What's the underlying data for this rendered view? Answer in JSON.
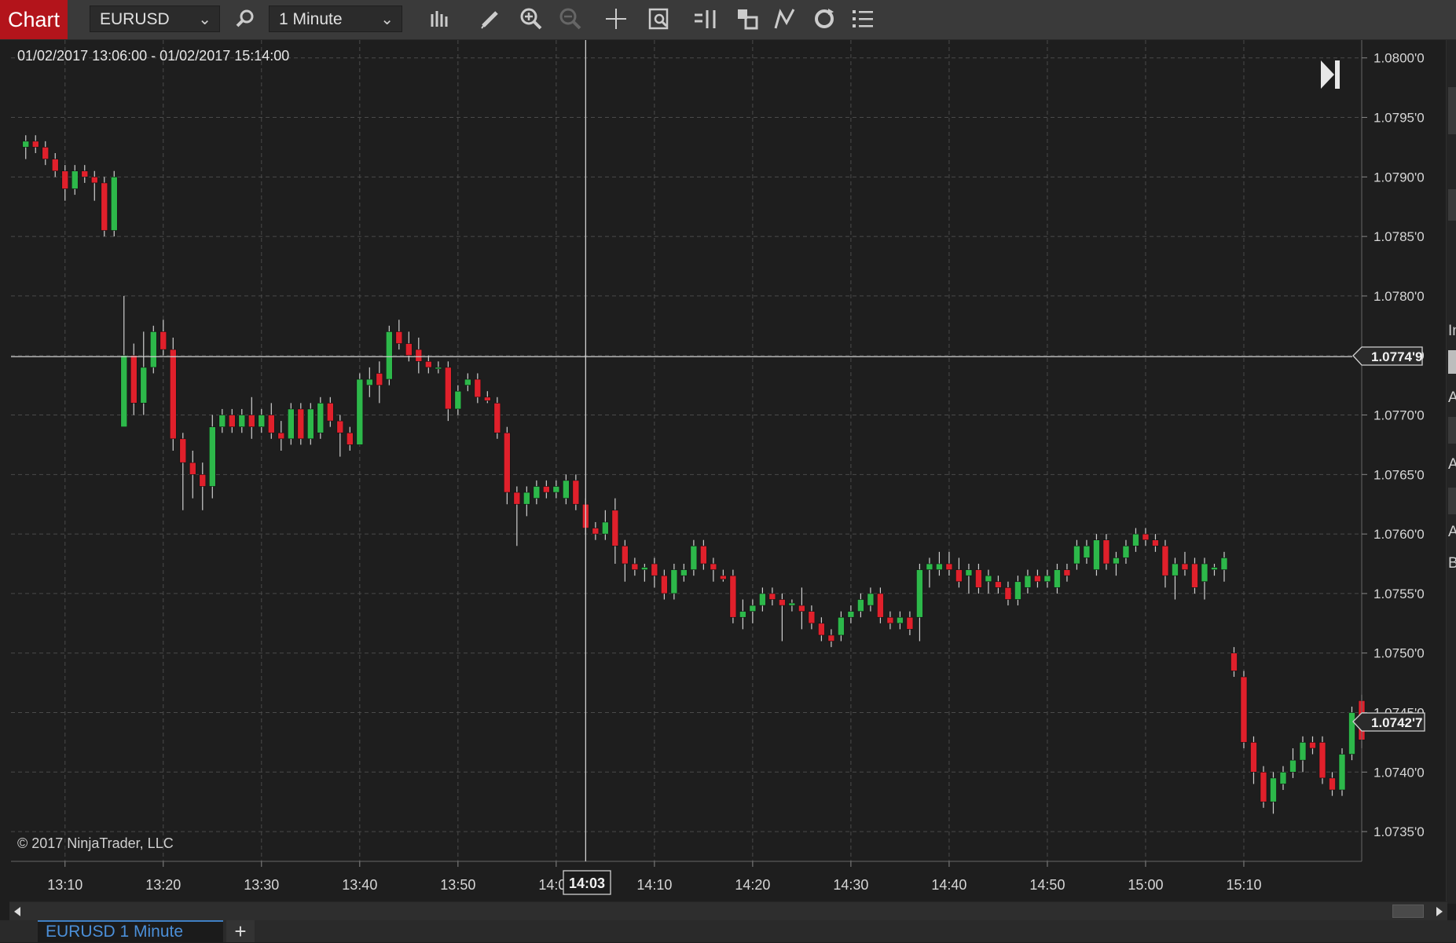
{
  "toolbar": {
    "tab_label": "Chart",
    "instrument": "EURUSD",
    "interval": "1 Minute",
    "icons": [
      "search-icon",
      "bar-type-icon",
      "drawing-pencil-icon",
      "zoom-in-icon",
      "zoom-out-icon",
      "crosshair-icon",
      "data-box-icon",
      "bar-spacing-icon",
      "overlay-icon",
      "indicators-icon",
      "reload-icon",
      "properties-list-icon"
    ]
  },
  "chart": {
    "date_range": "01/02/2017 13:06:00 - 01/02/2017 15:14:00",
    "copyright": "© 2017 NinjaTrader, LLC",
    "crosshair_time": "14:03",
    "crosshair_price": "1.0774'9",
    "last_price": "1.0742'7",
    "colors": {
      "up": "#2db84a",
      "down": "#e0202b",
      "background": "#1e1e1e",
      "grid": "#4a4a4a"
    }
  },
  "chart_data": {
    "type": "candlestick",
    "y_ticks": [
      "1.0800'0",
      "1.0795'0",
      "1.0790'0",
      "1.0785'0",
      "1.0780'0",
      "1.0775'0",
      "1.0770'0",
      "1.0765'0",
      "1.0760'0",
      "1.0755'0",
      "1.0750'0",
      "1.0745'0",
      "1.0740'0",
      "1.0735'0"
    ],
    "x_ticks": [
      "13:10",
      "13:20",
      "13:30",
      "13:40",
      "13:50",
      "14:00",
      "14:10",
      "14:20",
      "14:30",
      "14:40",
      "14:50",
      "15:00",
      "15:10"
    ],
    "ylim": [
      1.07325,
      1.08015
    ],
    "xlim_minutes_from_1306": [
      -1.5,
      136
    ],
    "candles": [
      [
        0,
        1.07925,
        1.07935,
        1.07915,
        1.0793
      ],
      [
        1,
        1.0793,
        1.07935,
        1.0792,
        1.07925
      ],
      [
        2,
        1.07925,
        1.0793,
        1.0791,
        1.07915
      ],
      [
        3,
        1.07915,
        1.0792,
        1.079,
        1.07905
      ],
      [
        4,
        1.07905,
        1.0791,
        1.0788,
        1.0789
      ],
      [
        5,
        1.0789,
        1.0791,
        1.07885,
        1.07905
      ],
      [
        6,
        1.07905,
        1.0791,
        1.07895,
        1.079
      ],
      [
        7,
        1.079,
        1.07905,
        1.0788,
        1.07895
      ],
      [
        8,
        1.07895,
        1.079,
        1.0785,
        1.07855
      ],
      [
        9,
        1.07855,
        1.07905,
        1.0785,
        1.079
      ],
      [
        10,
        1.0769,
        1.078,
        1.0769,
        1.0775
      ],
      [
        11,
        1.0775,
        1.0776,
        1.077,
        1.0771
      ],
      [
        12,
        1.0771,
        1.0777,
        1.077,
        1.0774
      ],
      [
        13,
        1.0774,
        1.07775,
        1.07735,
        1.0777
      ],
      [
        14,
        1.0777,
        1.0778,
        1.0775,
        1.07755
      ],
      [
        15,
        1.07755,
        1.07765,
        1.0767,
        1.0768
      ],
      [
        16,
        1.0768,
        1.07685,
        1.0762,
        1.0766
      ],
      [
        17,
        1.0766,
        1.0767,
        1.0763,
        1.0765
      ],
      [
        18,
        1.0765,
        1.0766,
        1.0762,
        1.0764
      ],
      [
        19,
        1.0764,
        1.077,
        1.0763,
        1.0769
      ],
      [
        20,
        1.0769,
        1.07705,
        1.07685,
        1.077
      ],
      [
        21,
        1.077,
        1.07705,
        1.07685,
        1.0769
      ],
      [
        22,
        1.0769,
        1.07705,
        1.07685,
        1.077
      ],
      [
        23,
        1.077,
        1.07715,
        1.0768,
        1.0769
      ],
      [
        24,
        1.0769,
        1.07705,
        1.07685,
        1.077
      ],
      [
        25,
        1.077,
        1.0771,
        1.0768,
        1.07685
      ],
      [
        26,
        1.07685,
        1.07695,
        1.0767,
        1.0768
      ],
      [
        27,
        1.0768,
        1.0771,
        1.07675,
        1.07705
      ],
      [
        28,
        1.07705,
        1.0771,
        1.07675,
        1.0768
      ],
      [
        29,
        1.0768,
        1.0771,
        1.07675,
        1.07705
      ],
      [
        30,
        1.07685,
        1.07715,
        1.0768,
        1.0771
      ],
      [
        31,
        1.0771,
        1.07715,
        1.0769,
        1.07695
      ],
      [
        32,
        1.07695,
        1.077,
        1.07665,
        1.07685
      ],
      [
        33,
        1.07685,
        1.0769,
        1.0767,
        1.07675
      ],
      [
        34,
        1.07675,
        1.07735,
        1.07675,
        1.0773
      ],
      [
        35,
        1.07725,
        1.0774,
        1.07715,
        1.0773
      ],
      [
        36,
        1.07735,
        1.07745,
        1.0771,
        1.07725
      ],
      [
        37,
        1.0773,
        1.07775,
        1.07725,
        1.0777
      ],
      [
        38,
        1.0777,
        1.0778,
        1.07755,
        1.0776
      ],
      [
        39,
        1.0776,
        1.0777,
        1.07745,
        1.0775
      ],
      [
        40,
        1.07755,
        1.07765,
        1.07735,
        1.07745
      ],
      [
        41,
        1.07745,
        1.0775,
        1.07735,
        1.0774
      ],
      [
        42,
        1.0774,
        1.07745,
        1.07735,
        1.0774
      ],
      [
        43,
        1.0774,
        1.07745,
        1.07695,
        1.07705
      ],
      [
        44,
        1.07705,
        1.07725,
        1.077,
        1.0772
      ],
      [
        45,
        1.07725,
        1.07735,
        1.0772,
        1.0773
      ],
      [
        46,
        1.0773,
        1.07735,
        1.0771,
        1.07715
      ],
      [
        47,
        1.07715,
        1.0772,
        1.0771,
        1.07712
      ],
      [
        48,
        1.0771,
        1.07715,
        1.0768,
        1.07685
      ],
      [
        49,
        1.07685,
        1.0769,
        1.07625,
        1.07635
      ],
      [
        50,
        1.07635,
        1.0764,
        1.0759,
        1.07625
      ],
      [
        51,
        1.07625,
        1.0764,
        1.07615,
        1.07635
      ],
      [
        52,
        1.0763,
        1.07645,
        1.07625,
        1.0764
      ],
      [
        53,
        1.0764,
        1.07645,
        1.0763,
        1.07635
      ],
      [
        54,
        1.07635,
        1.07645,
        1.0763,
        1.0764
      ],
      [
        55,
        1.0763,
        1.0765,
        1.07625,
        1.07645
      ],
      [
        56,
        1.07645,
        1.0765,
        1.0762,
        1.07625
      ],
      [
        57,
        1.07625,
        1.0763,
        1.076,
        1.07605
      ],
      [
        58,
        1.07605,
        1.0761,
        1.07595,
        1.076
      ],
      [
        59,
        1.076,
        1.0762,
        1.07595,
        1.0761
      ],
      [
        60,
        1.0762,
        1.0763,
        1.07575,
        1.0759
      ],
      [
        61,
        1.0759,
        1.07595,
        1.0756,
        1.07575
      ],
      [
        62,
        1.07575,
        1.0758,
        1.07565,
        1.0757
      ],
      [
        63,
        1.0757,
        1.07575,
        1.0756,
        1.07572
      ],
      [
        64,
        1.07575,
        1.0758,
        1.07555,
        1.07565
      ],
      [
        65,
        1.07565,
        1.0757,
        1.07545,
        1.0755
      ],
      [
        66,
        1.0755,
        1.07575,
        1.07545,
        1.0757
      ],
      [
        67,
        1.07565,
        1.07575,
        1.0756,
        1.0757
      ],
      [
        68,
        1.0757,
        1.07595,
        1.07565,
        1.0759
      ],
      [
        69,
        1.0759,
        1.07595,
        1.0757,
        1.07575
      ],
      [
        70,
        1.07575,
        1.0758,
        1.0756,
        1.0757
      ],
      [
        71,
        1.07565,
        1.0757,
        1.0756,
        1.07562
      ],
      [
        72,
        1.07565,
        1.0757,
        1.07525,
        1.0753
      ],
      [
        73,
        1.0753,
        1.07545,
        1.0752,
        1.07535
      ],
      [
        74,
        1.07535,
        1.07545,
        1.07525,
        1.0754
      ],
      [
        75,
        1.0754,
        1.07555,
        1.07535,
        1.0755
      ],
      [
        76,
        1.0755,
        1.07555,
        1.0754,
        1.07545
      ],
      [
        77,
        1.07545,
        1.0755,
        1.0751,
        1.0754
      ],
      [
        78,
        1.0754,
        1.07545,
        1.07535,
        1.07542
      ],
      [
        79,
        1.0754,
        1.07555,
        1.0752,
        1.07535
      ],
      [
        80,
        1.07535,
        1.0754,
        1.0752,
        1.07525
      ],
      [
        81,
        1.07525,
        1.0753,
        1.0751,
        1.07515
      ],
      [
        82,
        1.07515,
        1.0752,
        1.07505,
        1.0751
      ],
      [
        83,
        1.07515,
        1.07535,
        1.0751,
        1.0753
      ],
      [
        84,
        1.0753,
        1.0754,
        1.07525,
        1.07535
      ],
      [
        85,
        1.07535,
        1.0755,
        1.0753,
        1.07545
      ],
      [
        86,
        1.0754,
        1.07555,
        1.07535,
        1.0755
      ],
      [
        87,
        1.0755,
        1.07555,
        1.07525,
        1.0753
      ],
      [
        88,
        1.0753,
        1.07535,
        1.0752,
        1.07525
      ],
      [
        89,
        1.07525,
        1.07535,
        1.0752,
        1.0753
      ],
      [
        90,
        1.0753,
        1.07535,
        1.07515,
        1.0752
      ],
      [
        91,
        1.0753,
        1.07575,
        1.0751,
        1.0757
      ],
      [
        92,
        1.0757,
        1.0758,
        1.07555,
        1.07575
      ],
      [
        93,
        1.0757,
        1.07585,
        1.07565,
        1.07575
      ],
      [
        94,
        1.07575,
        1.07585,
        1.07565,
        1.0757
      ],
      [
        95,
        1.0757,
        1.0758,
        1.07555,
        1.0756
      ],
      [
        96,
        1.07565,
        1.07575,
        1.0755,
        1.0757
      ],
      [
        97,
        1.0757,
        1.07575,
        1.0755,
        1.07555
      ],
      [
        98,
        1.0756,
        1.0757,
        1.0755,
        1.07565
      ],
      [
        99,
        1.0756,
        1.07565,
        1.0755,
        1.07555
      ],
      [
        100,
        1.07555,
        1.0756,
        1.0754,
        1.07545
      ],
      [
        101,
        1.07545,
        1.07565,
        1.0754,
        1.0756
      ],
      [
        102,
        1.07555,
        1.0757,
        1.0755,
        1.07565
      ],
      [
        103,
        1.07565,
        1.0757,
        1.07555,
        1.0756
      ],
      [
        104,
        1.0756,
        1.0757,
        1.07555,
        1.07565
      ],
      [
        105,
        1.07555,
        1.07575,
        1.0755,
        1.0757
      ],
      [
        106,
        1.0757,
        1.07575,
        1.0756,
        1.07565
      ],
      [
        107,
        1.07575,
        1.07595,
        1.0757,
        1.0759
      ],
      [
        108,
        1.0758,
        1.07595,
        1.07575,
        1.0759
      ],
      [
        109,
        1.0757,
        1.076,
        1.07565,
        1.07595
      ],
      [
        110,
        1.07595,
        1.076,
        1.0757,
        1.07575
      ],
      [
        111,
        1.07575,
        1.07585,
        1.07565,
        1.0758
      ],
      [
        112,
        1.0758,
        1.07595,
        1.07575,
        1.0759
      ],
      [
        113,
        1.0759,
        1.07605,
        1.07585,
        1.076
      ],
      [
        114,
        1.076,
        1.07605,
        1.0759,
        1.07595
      ],
      [
        115,
        1.07595,
        1.076,
        1.07585,
        1.0759
      ],
      [
        116,
        1.0759,
        1.07595,
        1.07555,
        1.07565
      ],
      [
        117,
        1.07565,
        1.0758,
        1.07545,
        1.07575
      ],
      [
        118,
        1.07575,
        1.07585,
        1.07565,
        1.0757
      ],
      [
        119,
        1.07575,
        1.0758,
        1.0755,
        1.07555
      ],
      [
        120,
        1.0756,
        1.0758,
        1.07545,
        1.07575
      ],
      [
        121,
        1.0757,
        1.07575,
        1.07565,
        1.07572
      ],
      [
        122,
        1.0757,
        1.07585,
        1.0756,
        1.0758
      ],
      [
        123,
        1.075,
        1.07505,
        1.0748,
        1.07485
      ],
      [
        124,
        1.0748,
        1.07485,
        1.0742,
        1.07425
      ],
      [
        125,
        1.07425,
        1.0743,
        1.0739,
        1.074
      ],
      [
        126,
        1.074,
        1.07405,
        1.0737,
        1.07375
      ],
      [
        127,
        1.07375,
        1.074,
        1.07365,
        1.07395
      ],
      [
        128,
        1.0739,
        1.07405,
        1.07385,
        1.074
      ],
      [
        129,
        1.074,
        1.0742,
        1.07395,
        1.0741
      ],
      [
        130,
        1.0741,
        1.0743,
        1.074,
        1.07425
      ],
      [
        131,
        1.07425,
        1.0743,
        1.07415,
        1.0742
      ],
      [
        132,
        1.07425,
        1.0743,
        1.0739,
        1.07395
      ],
      [
        133,
        1.07395,
        1.074,
        1.0738,
        1.07385
      ],
      [
        134,
        1.07385,
        1.0742,
        1.0738,
        1.07415
      ],
      [
        135,
        1.07415,
        1.07455,
        1.0741,
        1.0745
      ],
      [
        136,
        1.0746,
        1.07465,
        1.0742,
        1.07427
      ]
    ]
  },
  "right_panel": {
    "labels": [
      "In",
      "A",
      "A",
      "A",
      "B"
    ]
  },
  "bottom": {
    "tab_label": "EURUSD 1 Minute",
    "add_label": "+"
  }
}
